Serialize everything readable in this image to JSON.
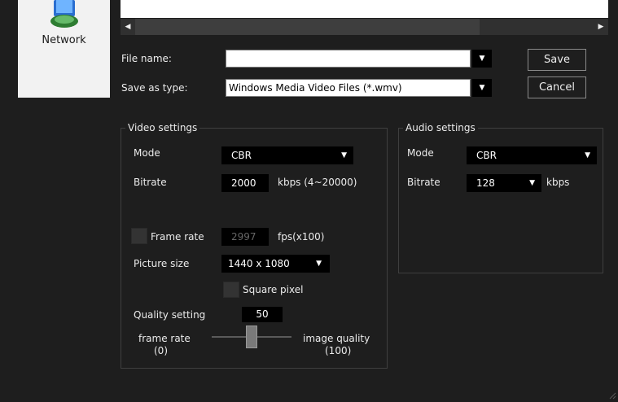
{
  "nav": {
    "network_label": "Network"
  },
  "file_dialog": {
    "file_name_label": "File name:",
    "file_name_value": "",
    "save_as_type_label": "Save as type:",
    "save_as_type_value": "Windows Media Video Files (*.wmv)",
    "save_button": "Save",
    "cancel_button": "Cancel"
  },
  "video_settings": {
    "title": "Video settings",
    "mode_label": "Mode",
    "mode_value": "CBR",
    "bitrate_label": "Bitrate",
    "bitrate_value": "2000",
    "bitrate_unit": "kbps (4~20000)",
    "frame_rate_label": "Frame rate",
    "frame_rate_value": "2997",
    "frame_rate_unit": "fps(x100)",
    "picture_size_label": "Picture size",
    "picture_size_value": "1440 x 1080",
    "square_pixel_label": "Square pixel",
    "quality_setting_label": "Quality setting",
    "quality_value": "50",
    "slider_left_label": "frame rate",
    "slider_left_value": "(0)",
    "slider_right_label": "image quality",
    "slider_right_value": "(100)",
    "slider_position": 0.5
  },
  "audio_settings": {
    "title": "Audio settings",
    "mode_label": "Mode",
    "mode_value": "CBR",
    "bitrate_label": "Bitrate",
    "bitrate_value": "128",
    "bitrate_unit": "kbps"
  },
  "icons": {
    "scroll_left": "triangle-left-icon",
    "scroll_right": "triangle-right-icon",
    "dropdown": "triangle-down-icon",
    "network": "network-computer-icon",
    "resize": "resize-grip-icon"
  },
  "colors": {
    "background": "#1e1e1e",
    "field_dark": "#000000",
    "nav_pane": "#f2f2f2"
  }
}
